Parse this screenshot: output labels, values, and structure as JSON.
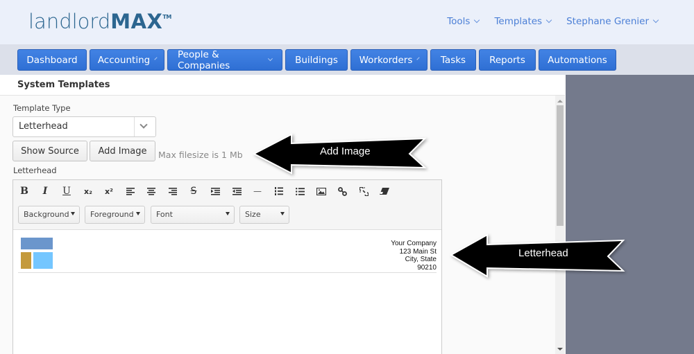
{
  "header": {
    "logo": {
      "light": "landlord",
      "bold": "MAX",
      "tm": "TM"
    },
    "top_nav": [
      {
        "label": "Tools",
        "has_dropdown": true
      },
      {
        "label": "Templates",
        "has_dropdown": true
      },
      {
        "label": "Stephane Grenier",
        "has_dropdown": true
      }
    ]
  },
  "main_nav": [
    {
      "label": "Dashboard",
      "has_dropdown": false
    },
    {
      "label": "Accounting",
      "has_dropdown": true
    },
    {
      "label": "People & Companies",
      "has_dropdown": true
    },
    {
      "label": "Buildings",
      "has_dropdown": false
    },
    {
      "label": "Workorders",
      "has_dropdown": true
    },
    {
      "label": "Tasks",
      "has_dropdown": false
    },
    {
      "label": "Reports",
      "has_dropdown": false
    },
    {
      "label": "Automations",
      "has_dropdown": false
    }
  ],
  "page": {
    "title": "System Templates",
    "template_type_label": "Template Type",
    "template_type_value": "Letterhead",
    "show_source_label": "Show Source",
    "add_image_label": "Add Image",
    "max_filesize_hint": "Max filesize is 1 Mb",
    "editor_label": "Letterhead"
  },
  "editor": {
    "toolbar_icons": [
      {
        "name": "bold-icon",
        "glyph": "B"
      },
      {
        "name": "italic-icon",
        "glyph": "I"
      },
      {
        "name": "underline-icon",
        "glyph": "U"
      },
      {
        "name": "subscript-icon",
        "glyph": "x₂"
      },
      {
        "name": "superscript-icon",
        "glyph": "x²"
      },
      {
        "name": "align-left-icon",
        "glyph": ""
      },
      {
        "name": "align-center-icon",
        "glyph": ""
      },
      {
        "name": "align-right-icon",
        "glyph": ""
      },
      {
        "name": "strikethrough-icon",
        "glyph": "S"
      },
      {
        "name": "indent-icon",
        "glyph": ""
      },
      {
        "name": "outdent-icon",
        "glyph": ""
      },
      {
        "name": "horizontal-rule-icon",
        "glyph": "—"
      },
      {
        "name": "ordered-list-icon",
        "glyph": ""
      },
      {
        "name": "unordered-list-icon",
        "glyph": ""
      },
      {
        "name": "image-icon",
        "glyph": ""
      },
      {
        "name": "link-icon",
        "glyph": ""
      },
      {
        "name": "unlink-icon",
        "glyph": ""
      },
      {
        "name": "eraser-icon",
        "glyph": ""
      }
    ],
    "selects": [
      {
        "label": "Background"
      },
      {
        "label": "Foreground"
      },
      {
        "label": "Font"
      },
      {
        "label": "Size"
      }
    ],
    "content": {
      "address_lines": [
        "Your Company",
        "123 Main St",
        "City, State",
        "90210"
      ],
      "logo_colors": {
        "top": "#6b96cc",
        "bottom_left": "#c49a3c",
        "bottom_right": "#74c6ff"
      }
    }
  },
  "callouts": [
    {
      "text": "Add Image"
    },
    {
      "text": "Letterhead"
    }
  ],
  "colors": {
    "brand": "#2c6690",
    "nav_button": "#3a7bdc",
    "top_link": "#4b7fd6",
    "side_panel": "#747a8c"
  }
}
